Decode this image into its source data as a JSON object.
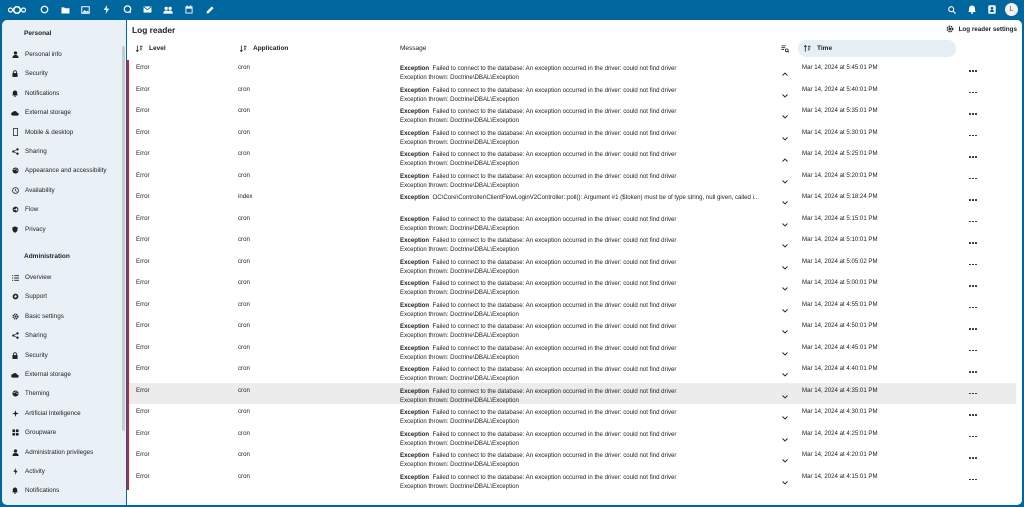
{
  "topbar": {
    "logo_icon": "nextcloud-logo-icon",
    "apps": [
      {
        "name": "dashboard",
        "icon": "dashboard-icon"
      },
      {
        "name": "files",
        "icon": "folder-icon"
      },
      {
        "name": "photos",
        "icon": "image-icon"
      },
      {
        "name": "activity",
        "icon": "lightning-icon"
      },
      {
        "name": "talk",
        "icon": "chat-icon"
      },
      {
        "name": "mail",
        "icon": "mail-icon"
      },
      {
        "name": "contacts",
        "icon": "contacts-icon"
      },
      {
        "name": "calendar",
        "icon": "calendar-icon"
      },
      {
        "name": "notes",
        "icon": "pencil-icon"
      }
    ],
    "right": [
      "search-icon",
      "bell-icon",
      "contacts-menu-icon"
    ],
    "avatar_initial": "L"
  },
  "sidebar": {
    "personal_title": "Personal",
    "personal": [
      {
        "label": "Personal info",
        "icon": "person-icon"
      },
      {
        "label": "Security",
        "icon": "lock-icon"
      },
      {
        "label": "Notifications",
        "icon": "bell-icon"
      },
      {
        "label": "External storage",
        "icon": "cloud-icon"
      },
      {
        "label": "Mobile & desktop",
        "icon": "phone-icon"
      },
      {
        "label": "Sharing",
        "icon": "share-icon"
      },
      {
        "label": "Appearance and accessibility",
        "icon": "palette-icon"
      },
      {
        "label": "Availability",
        "icon": "clock-icon"
      },
      {
        "label": "Flow",
        "icon": "flow-icon"
      },
      {
        "label": "Privacy",
        "icon": "shield-icon"
      }
    ],
    "admin_title": "Administration",
    "administration": [
      {
        "label": "Overview",
        "icon": "list-icon"
      },
      {
        "label": "Support",
        "icon": "support-icon"
      },
      {
        "label": "Basic settings",
        "icon": "gear-icon"
      },
      {
        "label": "Sharing",
        "icon": "share-icon"
      },
      {
        "label": "Security",
        "icon": "lock-icon"
      },
      {
        "label": "External storage",
        "icon": "cloud-icon"
      },
      {
        "label": "Theming",
        "icon": "palette-icon"
      },
      {
        "label": "Artificial Intelligence",
        "icon": "ai-icon"
      },
      {
        "label": "Groupware",
        "icon": "groupware-icon"
      },
      {
        "label": "Administration privileges",
        "icon": "person-icon"
      },
      {
        "label": "Activity",
        "icon": "lightning-icon"
      },
      {
        "label": "Notifications",
        "icon": "bell-icon"
      }
    ]
  },
  "page": {
    "title": "Log reader",
    "settings_label": "Log reader settings",
    "columns": {
      "level": "Level",
      "application": "Application",
      "message": "Message",
      "time": "Time"
    },
    "accent": "#00679e",
    "error_color": "#d21e2b"
  },
  "rows": [
    {
      "level": "Error",
      "app": "cron",
      "exc": "Exception",
      "msg": "Failed to connect to the database: An exception occurred in the driver: could not find driver",
      "line2": "Exception thrown: Doctrine\\DBAL\\Exception",
      "time": "Mar 14, 2024 at 5:45:01 PM",
      "expanded": true
    },
    {
      "level": "Error",
      "app": "cron",
      "exc": "Exception",
      "msg": "Failed to connect to the database: An exception occurred in the driver: could not find driver",
      "line2": "Exception thrown: Doctrine\\DBAL\\Exception",
      "time": "Mar 14, 2024 at 5:40:01 PM",
      "expanded": false
    },
    {
      "level": "Error",
      "app": "cron",
      "exc": "Exception",
      "msg": "Failed to connect to the database: An exception occurred in the driver: could not find driver",
      "line2": "Exception thrown: Doctrine\\DBAL\\Exception",
      "time": "Mar 14, 2024 at 5:35:01 PM",
      "expanded": false
    },
    {
      "level": "Error",
      "app": "cron",
      "exc": "Exception",
      "msg": "Failed to connect to the database: An exception occurred in the driver: could not find driver",
      "line2": "Exception thrown: Doctrine\\DBAL\\Exception",
      "time": "Mar 14, 2024 at 5:30:01 PM",
      "expanded": false
    },
    {
      "level": "Error",
      "app": "cron",
      "exc": "Exception",
      "msg": "Failed to connect to the database: An exception occurred in the driver: could not find driver",
      "line2": "Exception thrown: Doctrine\\DBAL\\Exception",
      "time": "Mar 14, 2024 at 5:25:01 PM",
      "expanded": true
    },
    {
      "level": "Error",
      "app": "cron",
      "exc": "Exception",
      "msg": "Failed to connect to the database: An exception occurred in the driver: could not find driver",
      "line2": "Exception thrown: Doctrine\\DBAL\\Exception",
      "time": "Mar 14, 2024 at 5:20:01 PM",
      "expanded": false
    },
    {
      "level": "Error",
      "app": "index",
      "exc": "Exception",
      "msg": "OC\\Core\\Controller\\ClientFlowLoginV2Controller::poll(): Argument #1 ($token) must be of type string, null given, called i...",
      "line2": "",
      "time": "Mar 14, 2024 at 5:18:24 PM",
      "expanded": false
    },
    {
      "level": "Error",
      "app": "cron",
      "exc": "Exception",
      "msg": "Failed to connect to the database: An exception occurred in the driver: could not find driver",
      "line2": "Exception thrown: Doctrine\\DBAL\\Exception",
      "time": "Mar 14, 2024 at 5:15:01 PM",
      "expanded": false
    },
    {
      "level": "Error",
      "app": "cron",
      "exc": "Exception",
      "msg": "Failed to connect to the database: An exception occurred in the driver: could not find driver",
      "line2": "Exception thrown: Doctrine\\DBAL\\Exception",
      "time": "Mar 14, 2024 at 5:10:01 PM",
      "expanded": false
    },
    {
      "level": "Error",
      "app": "cron",
      "exc": "Exception",
      "msg": "Failed to connect to the database: An exception occurred in the driver: could not find driver",
      "line2": "Exception thrown: Doctrine\\DBAL\\Exception",
      "time": "Mar 14, 2024 at 5:05:02 PM",
      "expanded": false
    },
    {
      "level": "Error",
      "app": "cron",
      "exc": "Exception",
      "msg": "Failed to connect to the database: An exception occurred in the driver: could not find driver",
      "line2": "Exception thrown: Doctrine\\DBAL\\Exception",
      "time": "Mar 14, 2024 at 5:00:01 PM",
      "expanded": false
    },
    {
      "level": "Error",
      "app": "cron",
      "exc": "Exception",
      "msg": "Failed to connect to the database: An exception occurred in the driver: could not find driver",
      "line2": "Exception thrown: Doctrine\\DBAL\\Exception",
      "time": "Mar 14, 2024 at 4:55:01 PM",
      "expanded": false
    },
    {
      "level": "Error",
      "app": "cron",
      "exc": "Exception",
      "msg": "Failed to connect to the database: An exception occurred in the driver: could not find driver",
      "line2": "Exception thrown: Doctrine\\DBAL\\Exception",
      "time": "Mar 14, 2024 at 4:50:01 PM",
      "expanded": false
    },
    {
      "level": "Error",
      "app": "cron",
      "exc": "Exception",
      "msg": "Failed to connect to the database: An exception occurred in the driver: could not find driver",
      "line2": "Exception thrown: Doctrine\\DBAL\\Exception",
      "time": "Mar 14, 2024 at 4:45:01 PM",
      "expanded": false
    },
    {
      "level": "Error",
      "app": "cron",
      "exc": "Exception",
      "msg": "Failed to connect to the database: An exception occurred in the driver: could not find driver",
      "line2": "Exception thrown: Doctrine\\DBAL\\Exception",
      "time": "Mar 14, 2024 at 4:40:01 PM",
      "expanded": false
    },
    {
      "level": "Error",
      "app": "cron",
      "exc": "Exception",
      "msg": "Failed to connect to the database: An exception occurred in the driver: could not find driver",
      "line2": "Exception thrown: Doctrine\\DBAL\\Exception",
      "time": "Mar 14, 2024 at 4:35:01 PM",
      "expanded": false,
      "highlighted": true
    },
    {
      "level": "Error",
      "app": "cron",
      "exc": "Exception",
      "msg": "Failed to connect to the database: An exception occurred in the driver: could not find driver",
      "line2": "Exception thrown: Doctrine\\DBAL\\Exception",
      "time": "Mar 14, 2024 at 4:30:01 PM",
      "expanded": false
    },
    {
      "level": "Error",
      "app": "cron",
      "exc": "Exception",
      "msg": "Failed to connect to the database: An exception occurred in the driver: could not find driver",
      "line2": "Exception thrown: Doctrine\\DBAL\\Exception",
      "time": "Mar 14, 2024 at 4:25:01 PM",
      "expanded": false
    },
    {
      "level": "Error",
      "app": "cron",
      "exc": "Exception",
      "msg": "Failed to connect to the database: An exception occurred in the driver: could not find driver",
      "line2": "Exception thrown: Doctrine\\DBAL\\Exception",
      "time": "Mar 14, 2024 at 4:20:01 PM",
      "expanded": false
    },
    {
      "level": "Error",
      "app": "cron",
      "exc": "Exception",
      "msg": "Failed to connect to the database: An exception occurred in the driver: could not find driver",
      "line2": "Exception thrown: Doctrine\\DBAL\\Exception",
      "time": "Mar 14, 2024 at 4:15:01 PM",
      "expanded": false
    }
  ]
}
